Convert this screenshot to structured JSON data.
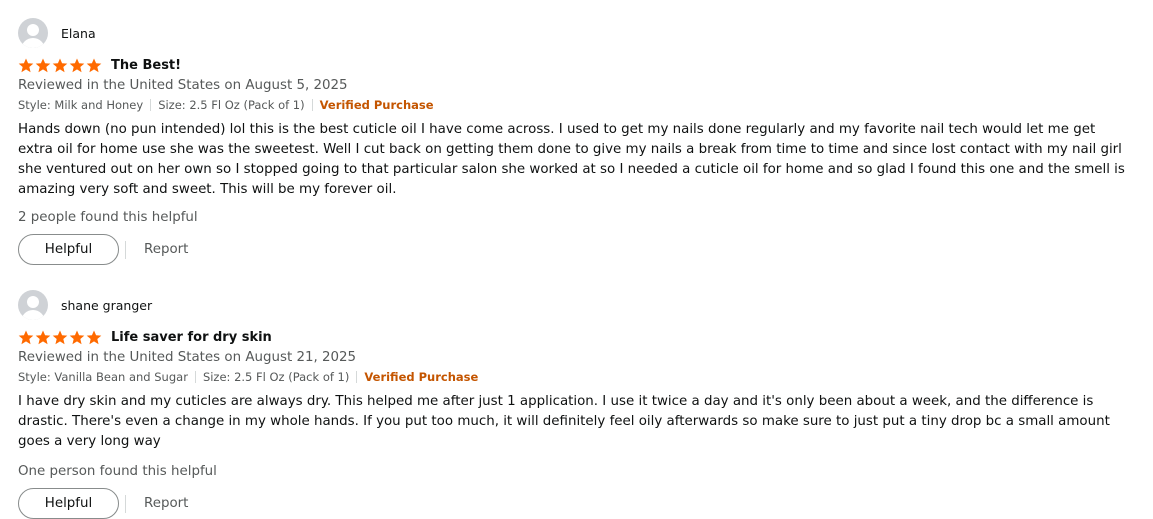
{
  "colors": {
    "star": "#ff6a00",
    "verified": "#c45500",
    "secondary_text": "#565959"
  },
  "reviews": [
    {
      "reviewer": "Elana",
      "avatar_icon": "user-avatar-icon",
      "rating": 5,
      "title": "The Best!",
      "date": "Reviewed in the United States on August 5, 2025",
      "style": "Style: Milk and Honey",
      "size": "Size: 2.5 Fl Oz (Pack of 1)",
      "verified": "Verified Purchase",
      "body": "Hands down (no pun intended) lol this is the best cuticle oil I have come across. I used to get my nails done regularly and my favorite nail tech would let me get extra oil for home use she was the sweetest. Well I cut back on getting them done to give my nails a break from time to time and since lost contact with my nail girl she ventured out on her own so I stopped going to that particular salon she worked at so I needed a cuticle oil for home and so glad I found this one and the smell is amazing very soft and sweet. This will be my forever oil.",
      "helpful_count": "2 people found this helpful",
      "helpful_button": "Helpful",
      "report_link": "Report"
    },
    {
      "reviewer": "shane granger",
      "avatar_icon": "user-avatar-icon",
      "rating": 5,
      "title": "Life saver for dry skin",
      "date": "Reviewed in the United States on August 21, 2025",
      "style": "Style: Vanilla Bean and Sugar",
      "size": "Size: 2.5 Fl Oz (Pack of 1)",
      "verified": "Verified Purchase",
      "body": "I have dry skin and my cuticles are always dry. This helped me after just 1 application. I use it twice a day and it's only been about a week, and the difference is drastic. There's even a change in my whole hands. If you put too much, it will definitely feel oily afterwards so make sure to just put a tiny drop bc a small amount goes a very long way",
      "helpful_count": "One person found this helpful",
      "helpful_button": "Helpful",
      "report_link": "Report"
    }
  ]
}
